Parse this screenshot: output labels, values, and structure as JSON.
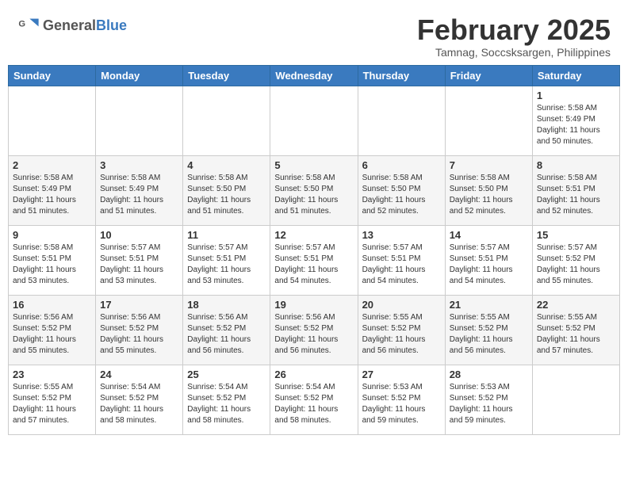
{
  "header": {
    "logo_general": "General",
    "logo_blue": "Blue",
    "month_title": "February 2025",
    "location": "Tamnag, Soccsksargen, Philippines"
  },
  "days_of_week": [
    "Sunday",
    "Monday",
    "Tuesday",
    "Wednesday",
    "Thursday",
    "Friday",
    "Saturday"
  ],
  "weeks": [
    [
      {
        "day": "",
        "info": ""
      },
      {
        "day": "",
        "info": ""
      },
      {
        "day": "",
        "info": ""
      },
      {
        "day": "",
        "info": ""
      },
      {
        "day": "",
        "info": ""
      },
      {
        "day": "",
        "info": ""
      },
      {
        "day": "1",
        "info": "Sunrise: 5:58 AM\nSunset: 5:49 PM\nDaylight: 11 hours\nand 50 minutes."
      }
    ],
    [
      {
        "day": "2",
        "info": "Sunrise: 5:58 AM\nSunset: 5:49 PM\nDaylight: 11 hours\nand 51 minutes."
      },
      {
        "day": "3",
        "info": "Sunrise: 5:58 AM\nSunset: 5:49 PM\nDaylight: 11 hours\nand 51 minutes."
      },
      {
        "day": "4",
        "info": "Sunrise: 5:58 AM\nSunset: 5:50 PM\nDaylight: 11 hours\nand 51 minutes."
      },
      {
        "day": "5",
        "info": "Sunrise: 5:58 AM\nSunset: 5:50 PM\nDaylight: 11 hours\nand 51 minutes."
      },
      {
        "day": "6",
        "info": "Sunrise: 5:58 AM\nSunset: 5:50 PM\nDaylight: 11 hours\nand 52 minutes."
      },
      {
        "day": "7",
        "info": "Sunrise: 5:58 AM\nSunset: 5:50 PM\nDaylight: 11 hours\nand 52 minutes."
      },
      {
        "day": "8",
        "info": "Sunrise: 5:58 AM\nSunset: 5:51 PM\nDaylight: 11 hours\nand 52 minutes."
      }
    ],
    [
      {
        "day": "9",
        "info": "Sunrise: 5:58 AM\nSunset: 5:51 PM\nDaylight: 11 hours\nand 53 minutes."
      },
      {
        "day": "10",
        "info": "Sunrise: 5:57 AM\nSunset: 5:51 PM\nDaylight: 11 hours\nand 53 minutes."
      },
      {
        "day": "11",
        "info": "Sunrise: 5:57 AM\nSunset: 5:51 PM\nDaylight: 11 hours\nand 53 minutes."
      },
      {
        "day": "12",
        "info": "Sunrise: 5:57 AM\nSunset: 5:51 PM\nDaylight: 11 hours\nand 54 minutes."
      },
      {
        "day": "13",
        "info": "Sunrise: 5:57 AM\nSunset: 5:51 PM\nDaylight: 11 hours\nand 54 minutes."
      },
      {
        "day": "14",
        "info": "Sunrise: 5:57 AM\nSunset: 5:51 PM\nDaylight: 11 hours\nand 54 minutes."
      },
      {
        "day": "15",
        "info": "Sunrise: 5:57 AM\nSunset: 5:52 PM\nDaylight: 11 hours\nand 55 minutes."
      }
    ],
    [
      {
        "day": "16",
        "info": "Sunrise: 5:56 AM\nSunset: 5:52 PM\nDaylight: 11 hours\nand 55 minutes."
      },
      {
        "day": "17",
        "info": "Sunrise: 5:56 AM\nSunset: 5:52 PM\nDaylight: 11 hours\nand 55 minutes."
      },
      {
        "day": "18",
        "info": "Sunrise: 5:56 AM\nSunset: 5:52 PM\nDaylight: 11 hours\nand 56 minutes."
      },
      {
        "day": "19",
        "info": "Sunrise: 5:56 AM\nSunset: 5:52 PM\nDaylight: 11 hours\nand 56 minutes."
      },
      {
        "day": "20",
        "info": "Sunrise: 5:55 AM\nSunset: 5:52 PM\nDaylight: 11 hours\nand 56 minutes."
      },
      {
        "day": "21",
        "info": "Sunrise: 5:55 AM\nSunset: 5:52 PM\nDaylight: 11 hours\nand 56 minutes."
      },
      {
        "day": "22",
        "info": "Sunrise: 5:55 AM\nSunset: 5:52 PM\nDaylight: 11 hours\nand 57 minutes."
      }
    ],
    [
      {
        "day": "23",
        "info": "Sunrise: 5:55 AM\nSunset: 5:52 PM\nDaylight: 11 hours\nand 57 minutes."
      },
      {
        "day": "24",
        "info": "Sunrise: 5:54 AM\nSunset: 5:52 PM\nDaylight: 11 hours\nand 58 minutes."
      },
      {
        "day": "25",
        "info": "Sunrise: 5:54 AM\nSunset: 5:52 PM\nDaylight: 11 hours\nand 58 minutes."
      },
      {
        "day": "26",
        "info": "Sunrise: 5:54 AM\nSunset: 5:52 PM\nDaylight: 11 hours\nand 58 minutes."
      },
      {
        "day": "27",
        "info": "Sunrise: 5:53 AM\nSunset: 5:52 PM\nDaylight: 11 hours\nand 59 minutes."
      },
      {
        "day": "28",
        "info": "Sunrise: 5:53 AM\nSunset: 5:52 PM\nDaylight: 11 hours\nand 59 minutes."
      },
      {
        "day": "",
        "info": ""
      }
    ]
  ]
}
